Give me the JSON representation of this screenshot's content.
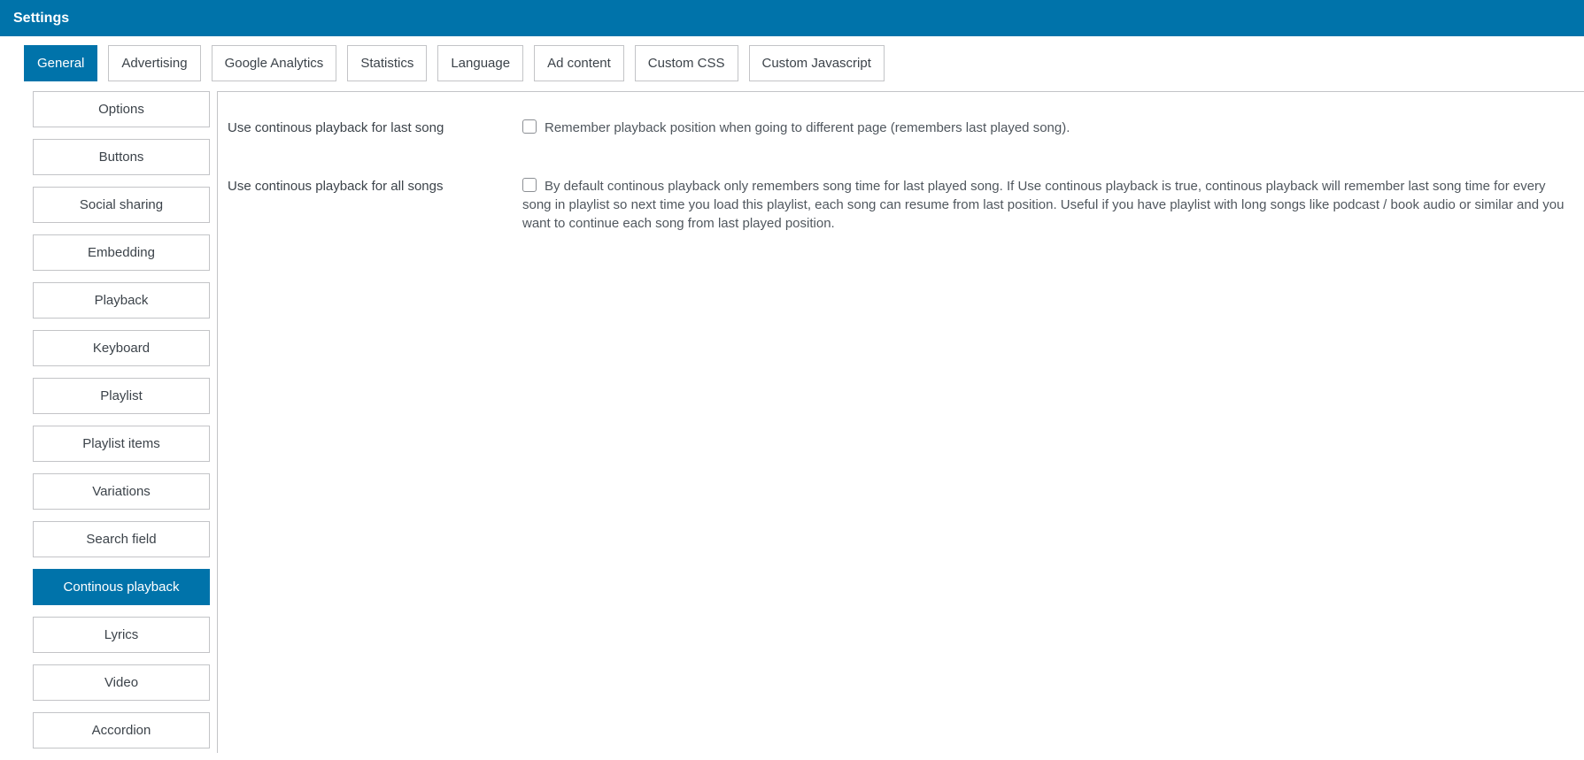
{
  "header": {
    "title": "Settings"
  },
  "tabs": [
    {
      "label": "General"
    },
    {
      "label": "Advertising"
    },
    {
      "label": "Google Analytics"
    },
    {
      "label": "Statistics"
    },
    {
      "label": "Language"
    },
    {
      "label": "Ad content"
    },
    {
      "label": "Custom CSS"
    },
    {
      "label": "Custom Javascript"
    }
  ],
  "active_tab": "General",
  "sidebar": {
    "items": [
      {
        "label": "Options"
      },
      {
        "label": "Buttons"
      },
      {
        "label": "Social sharing"
      },
      {
        "label": "Embedding"
      },
      {
        "label": "Playback"
      },
      {
        "label": "Keyboard"
      },
      {
        "label": "Playlist"
      },
      {
        "label": "Playlist items"
      },
      {
        "label": "Variations"
      },
      {
        "label": "Search field"
      },
      {
        "label": "Continous playback"
      },
      {
        "label": "Lyrics"
      },
      {
        "label": "Video"
      },
      {
        "label": "Accordion"
      }
    ],
    "active_item": "Continous playback"
  },
  "settings": [
    {
      "label": "Use continous playback for last song",
      "checked": false,
      "description": "Remember playback position when going to different page (remembers last played song)."
    },
    {
      "label": "Use continous playback for all songs",
      "checked": false,
      "description": "By default continous playback only remembers song time for last played song. If Use continous playback is true, continous playback will remember last song time for every song in playlist so next time you load this playlist, each song can resume from last position. Useful if you have playlist with long songs like podcast / book audio or similar and you want to continue each song from last played position."
    }
  ],
  "colors": {
    "accent": "#0073aa",
    "border": "#c3c4c7",
    "text": "#3c434a"
  }
}
